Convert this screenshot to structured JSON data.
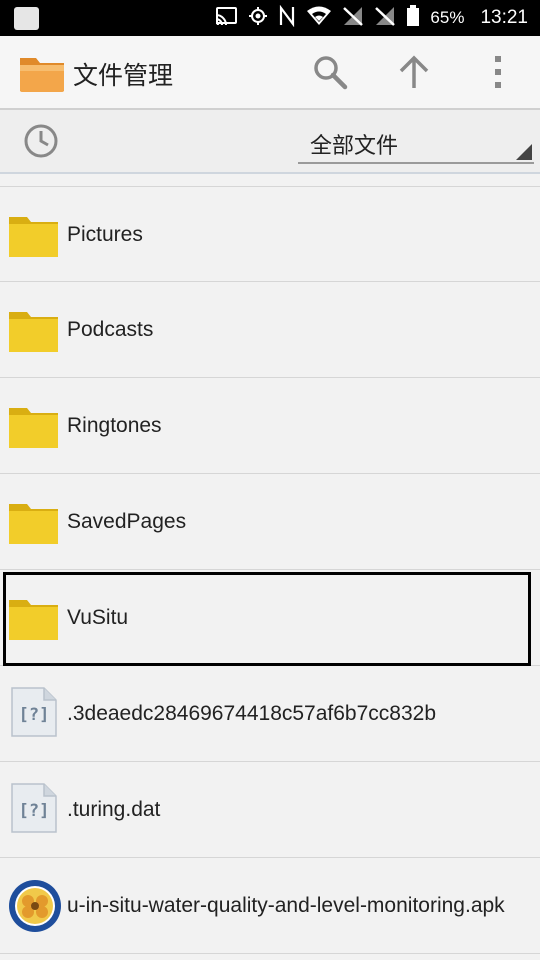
{
  "status_bar": {
    "battery_percent": "65%",
    "time": "13:21",
    "icons": [
      "notification-square-icon",
      "cast-icon",
      "gps-icon",
      "nfc-icon",
      "wifi-icon",
      "signal-off-icon",
      "signal-off-icon",
      "battery-icon"
    ]
  },
  "app_bar": {
    "title": "文件管理",
    "actions": [
      "search-icon",
      "arrow-up-icon",
      "overflow-menu-icon"
    ]
  },
  "filter": {
    "selected": "全部文件"
  },
  "files": [
    {
      "name": "Pictures",
      "type": "folder"
    },
    {
      "name": "Podcasts",
      "type": "folder"
    },
    {
      "name": "Ringtones",
      "type": "folder"
    },
    {
      "name": "SavedPages",
      "type": "folder"
    },
    {
      "name": "VuSitu",
      "type": "folder",
      "selected": true
    },
    {
      "name": ".3deaedc28469674418c57af6b7cc832b",
      "type": "unknown-file"
    },
    {
      "name": ".turing.dat",
      "type": "unknown-file"
    },
    {
      "name": "u-in-situ-water-quality-and-level-monitoring.apk",
      "type": "apk"
    }
  ],
  "colors": {
    "folder": "#f2cd2a",
    "folder_dark": "#d9ae12",
    "app_folder": "#f3a64a",
    "apk_bg": "#1f4e9c"
  }
}
